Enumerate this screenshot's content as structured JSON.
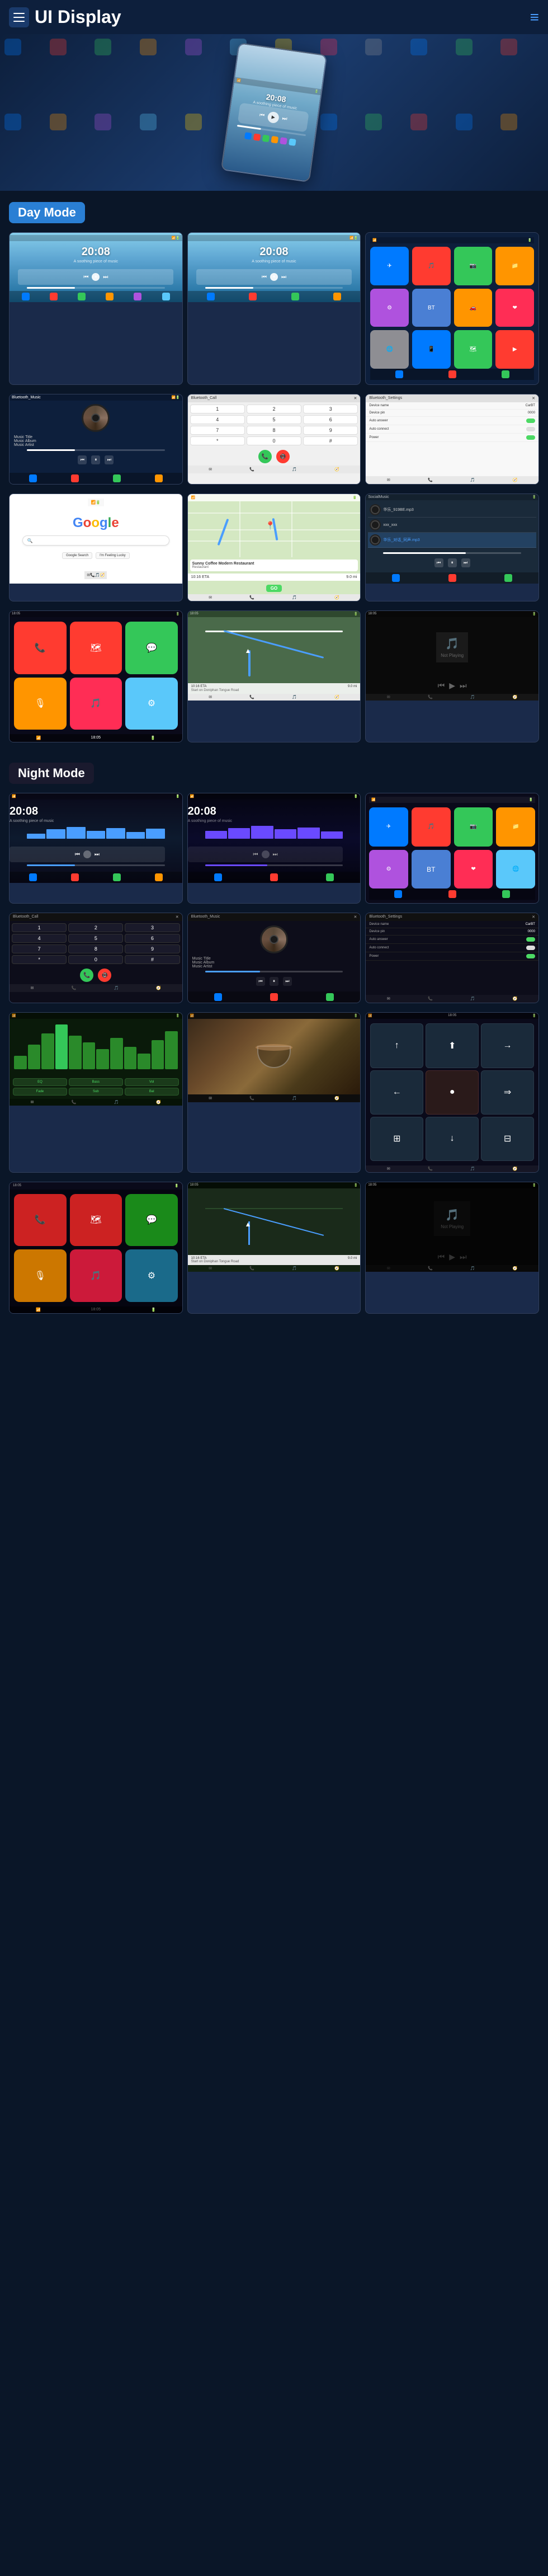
{
  "header": {
    "title": "UI Display",
    "menu_label": "≡"
  },
  "sections": {
    "day_mode": "Day Mode",
    "night_mode": "Night Mode"
  },
  "screens": {
    "time": "20:08",
    "subtitle": "A soothing piece of music",
    "music_title": "Music Title",
    "music_album": "Music Album",
    "music_artist": "Music Artist",
    "bluetooth_music": "Bluetooth_Music",
    "bluetooth_call": "Bluetooth_Call",
    "bluetooth_settings": "Bluetooth_Settings",
    "device_name_label": "Device name",
    "device_name_value": "CarBT",
    "device_pin_label": "Device pin",
    "device_pin_value": "0000",
    "auto_answer_label": "Auto answer",
    "auto_connect_label": "Auto connect",
    "power_label": "Power",
    "social_music": "SocialMusic",
    "google_text": "Google",
    "go_label": "GO",
    "sunny_coffee": "Sunny Coffee Modern Restaurant",
    "eta_label": "10:16 ETA",
    "eta_value": "9.0 mi",
    "start_label": "Start on Doniphan Tongue Road",
    "not_playing": "Not Playing"
  },
  "app_icons": {
    "colors": [
      "#007aff",
      "#ff3b30",
      "#34c759",
      "#ff9500",
      "#af52de",
      "#5ac8fa",
      "#ffcc00",
      "#ff2d55",
      "#8e8e93",
      "#0a3a6a",
      "#5ac8fa",
      "#ff6b35",
      "#4cd964",
      "#1a8a4a"
    ]
  },
  "phone_keys": [
    "1",
    "2",
    "3",
    "4",
    "5",
    "6",
    "7",
    "8",
    "9",
    "* ",
    "0",
    "#"
  ]
}
